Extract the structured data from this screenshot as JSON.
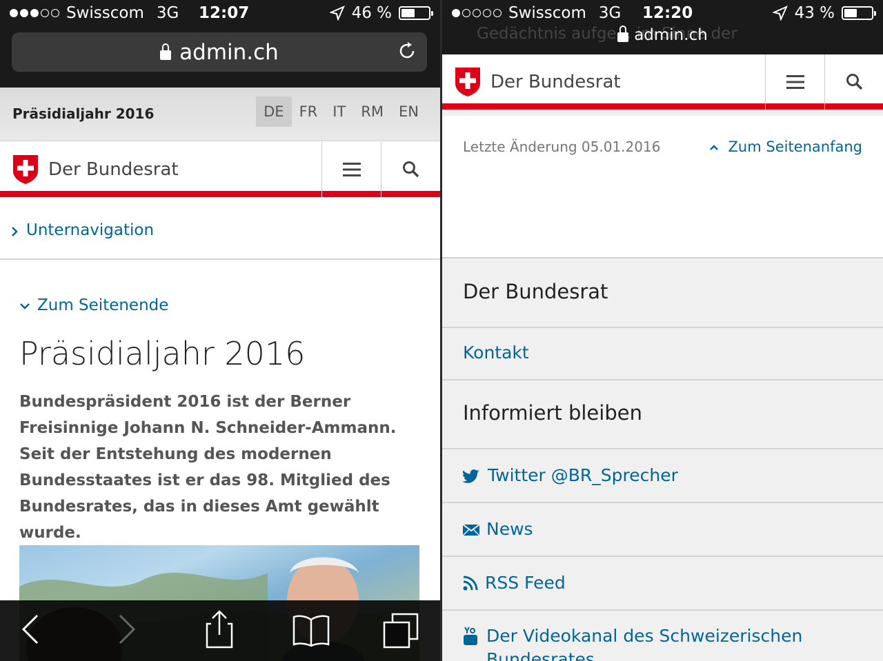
{
  "left": {
    "status": {
      "carrier": "Swisscom",
      "network": "3G",
      "time": "12:07",
      "battery": "46 %",
      "battery_level": 0.46,
      "signal_bars": 3
    },
    "url": "admin.ch",
    "lang_bar": {
      "title": "Präsidialjahr 2016",
      "languages": [
        "DE",
        "FR",
        "IT",
        "RM",
        "EN"
      ],
      "active": "DE"
    },
    "brand": "Der Bundesrat",
    "subnav": "Unternavigation",
    "to_end": "Zum Seitenende",
    "heading": "Präsidialjahr 2016",
    "lead": "Bundespräsident 2016 ist der Berner Freisinnige Johann N. Schneider-Ammann. Seit der Entstehung des modernen Bundesstaates ist er das 98. Mitglied des Bundesrates, das in dieses Amt gewählt wurde."
  },
  "right": {
    "status": {
      "carrier": "Swisscom",
      "network": "3G",
      "time": "12:20",
      "battery": "43 %",
      "battery_level": 0.43,
      "signal_bars": 1
    },
    "url": "admin.ch",
    "ghost_text": "Gedächtnis aufge... im Sinne der",
    "brand": "Der Bundesrat",
    "last_modified": "Letzte Änderung 05.01.2016",
    "to_top": "Zum Seitenanfang",
    "footer": {
      "section1_title": "Der Bundesrat",
      "contact": "Kontakt",
      "section2_title": "Informiert bleiben",
      "twitter": "Twitter @BR_Sprecher",
      "news": "News",
      "rss": "RSS Feed",
      "video": "Der Videokanal des Schweizerischen Bundesrates"
    }
  },
  "colors": {
    "swiss_red": "#dc0018",
    "link": "#006699"
  }
}
